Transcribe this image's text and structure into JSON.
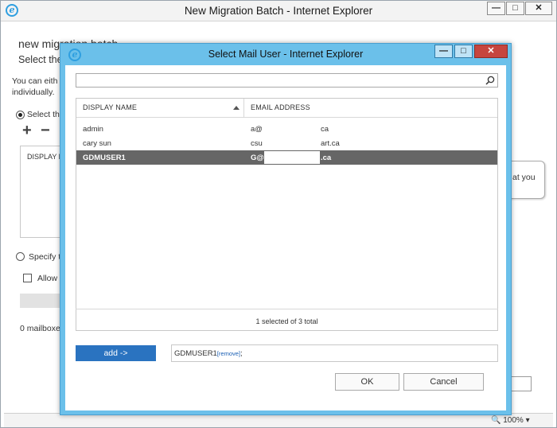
{
  "background_window": {
    "title": "New Migration Batch - Internet Explorer",
    "min": "—",
    "max": "□",
    "close": "✕",
    "heading": "new migration batch",
    "subheading": "Select the",
    "intro_line1": "You can eith",
    "intro_line2": "individually.",
    "radio_select_label": "Select th",
    "list_header": "DISPLAY N",
    "radio_specify_label": "Specify t",
    "allow_label": "Allow",
    "mailbox_count": "0 mailboxe",
    "tooltip_text": "at you",
    "zoom": "100%",
    "zoom_arrow": "▾"
  },
  "dialog": {
    "title": "Select Mail User - Internet Explorer",
    "min": "—",
    "max": "□",
    "close": "✕",
    "search_placeholder": "",
    "columns": {
      "display_name": "DISPLAY NAME",
      "email_address": "EMAIL ADDRESS"
    },
    "rows": [
      {
        "display_name": "admin",
        "email_prefix": "a@",
        "email_suffix": "ca",
        "selected": false
      },
      {
        "display_name": "cary sun",
        "email_prefix": "csu",
        "email_suffix": "art.ca",
        "selected": false
      },
      {
        "display_name": "GDMUSER1",
        "email_prefix": "G@",
        "email_suffix": ".ca",
        "selected": true
      }
    ],
    "count_text": "1 selected of 3 total",
    "add_button": "add ->",
    "selected_name": "GDMUSER1",
    "remove_link": "[remove]",
    "selected_suffix": ";",
    "ok_button": "OK",
    "cancel_button": "Cancel"
  },
  "colors": {
    "dialog_frame": "#6bc0ea",
    "selected_row": "#666666",
    "add_button": "#2a73c0",
    "close_button": "#c7453e"
  }
}
